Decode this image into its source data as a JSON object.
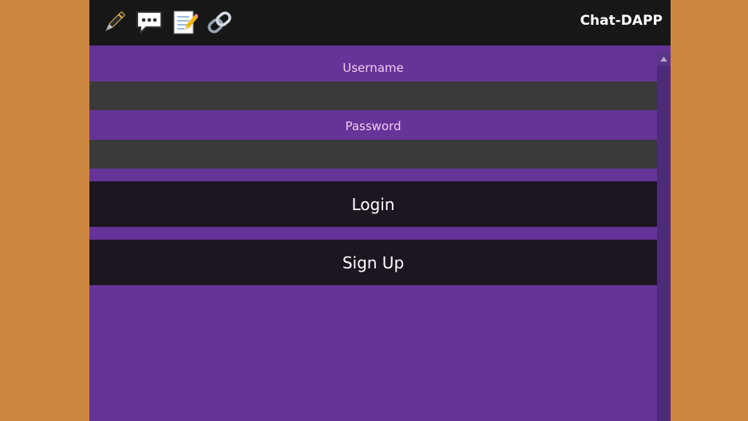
{
  "app": {
    "title": "Chat-DAPP"
  },
  "toolbar": {
    "icons": [
      "pen-icon",
      "chat-bubble-icon",
      "memo-icon",
      "link-icon"
    ]
  },
  "form": {
    "username_label": "Username",
    "username_value": "",
    "password_label": "Password",
    "password_value": "",
    "login_label": "Login",
    "signup_label": "Sign Up"
  },
  "colors": {
    "page_background": "#cd853f",
    "panel_background": "#663399",
    "topbar_background": "#171717",
    "input_background": "#3a3a3a",
    "button_background": "#1c1620",
    "label_color": "#f3cce8"
  }
}
